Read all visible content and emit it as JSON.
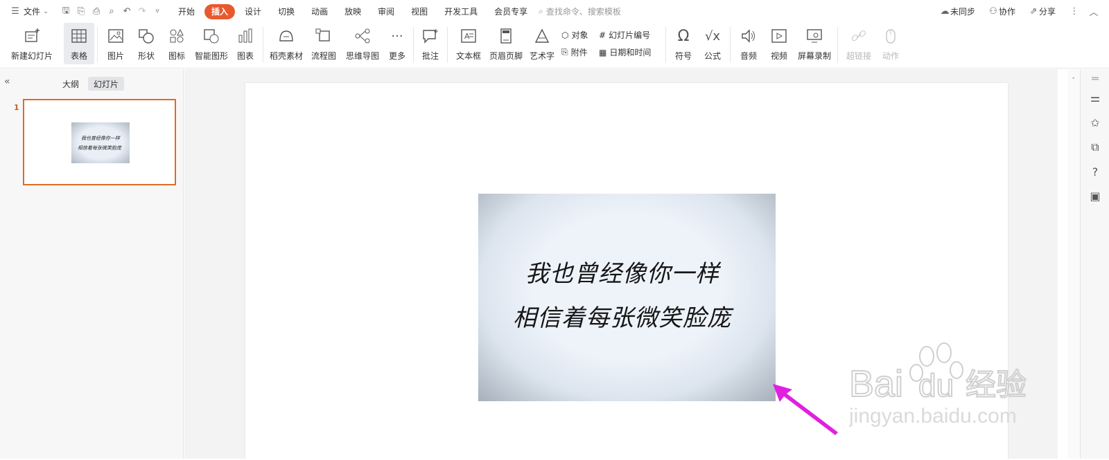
{
  "menu": {
    "file_label": "文件",
    "tabs": [
      "开始",
      "插入",
      "设计",
      "切换",
      "动画",
      "放映",
      "审阅",
      "视图",
      "开发工具",
      "会员专享"
    ],
    "active_tab": "插入",
    "search_placeholder": "查找命令、搜索模板",
    "unsync_label": "未同步",
    "collab_label": "协作",
    "share_label": "分享"
  },
  "ribbon": {
    "new_slide": "新建幻灯片",
    "table": "表格",
    "picture": "图片",
    "shape": "形状",
    "icon": "图标",
    "smart_graphic": "智能图形",
    "chart": "图表",
    "shell_material": "稻壳素材",
    "flowchart": "流程图",
    "mindmap": "思维导图",
    "more": "更多",
    "comment": "批注",
    "textbox": "文本框",
    "header_footer": "页眉页脚",
    "wordart": "艺术字",
    "object": "对象",
    "slide_number": "幻灯片编号",
    "attachment": "附件",
    "date_time": "日期和时间",
    "symbol": "符号",
    "formula": "公式",
    "audio": "音频",
    "video": "视频",
    "screen_record": "屏幕录制",
    "hyperlink": "超链接",
    "action": "动作"
  },
  "left_panel": {
    "tab_outline": "大纲",
    "tab_slides": "幻灯片",
    "slide_number": "1"
  },
  "slide": {
    "line1": "我也曾经像你一样",
    "line2": "相信着每张微笑脸庞"
  },
  "watermark": {
    "brand": "Bai du 经验",
    "url": "jingyan.baidu.com"
  },
  "colors": {
    "accent": "#e85a2e",
    "thumb_border": "#e06a24",
    "arrow": "#e020e0"
  }
}
